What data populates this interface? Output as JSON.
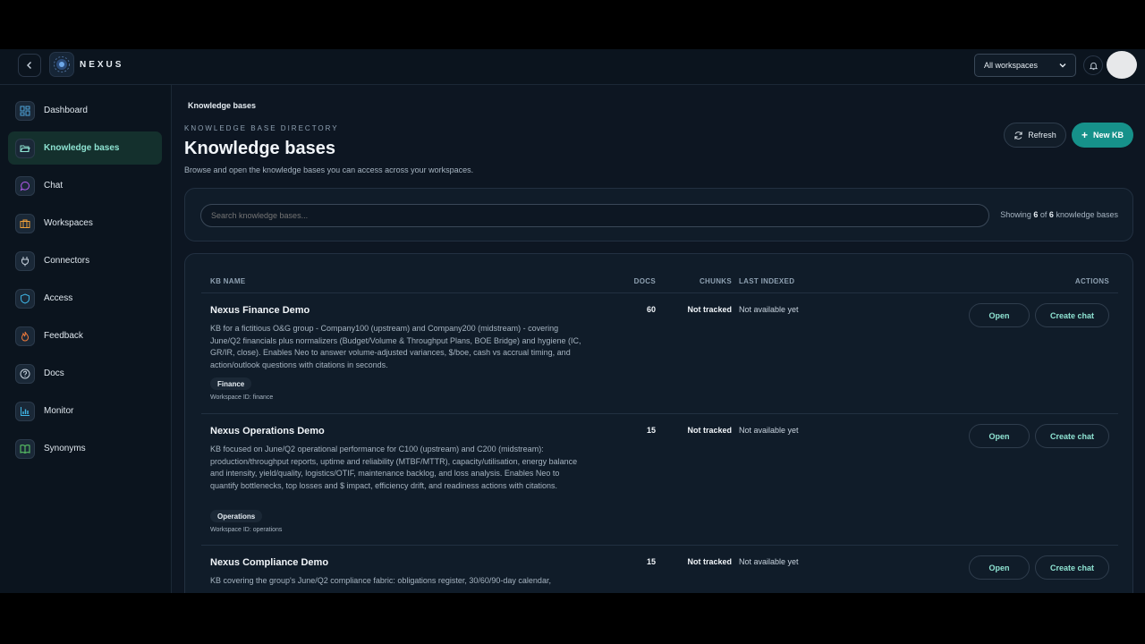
{
  "header": {
    "brand": "NEXUS",
    "workspace_select": "All workspaces",
    "icons": [
      "chevron-left-icon",
      "nexus-logo-icon",
      "bell-icon"
    ]
  },
  "sidebar": {
    "items": [
      {
        "label": "Dashboard",
        "icon": "dashboard-icon",
        "color": "#4fa3d9"
      },
      {
        "label": "Knowledge bases",
        "icon": "folder-open-icon",
        "color": "#8ee3d2",
        "active": true
      },
      {
        "label": "Chat",
        "icon": "chat-icon",
        "color": "#b45cf0"
      },
      {
        "label": "Workspaces",
        "icon": "briefcase-icon",
        "color": "#f0a13a"
      },
      {
        "label": "Connectors",
        "icon": "plug-icon",
        "color": "#c9d4df"
      },
      {
        "label": "Access",
        "icon": "shield-icon",
        "color": "#3fb7e8"
      },
      {
        "label": "Feedback",
        "icon": "flame-icon",
        "color": "#f07a3a"
      },
      {
        "label": "Docs",
        "icon": "help-circle-icon",
        "color": "#c9d4df"
      },
      {
        "label": "Monitor",
        "icon": "bar-chart-icon",
        "color": "#3fb7e8"
      },
      {
        "label": "Synonyms",
        "icon": "book-icon",
        "color": "#5fd36a"
      }
    ]
  },
  "main": {
    "breadcrumb": "Knowledge bases",
    "eyebrow": "KNOWLEDGE BASE DIRECTORY",
    "title": "Knowledge bases",
    "subtitle": "Browse and open the knowledge bases you can access across your workspaces.",
    "refresh_label": "Refresh",
    "new_label": "New KB",
    "search_placeholder": "Search knowledge bases...",
    "showing": {
      "prefix": "Showing",
      "count": "6",
      "of": "of",
      "total": "6",
      "suffix": "knowledge bases"
    }
  },
  "table": {
    "columns": {
      "name": "KB NAME",
      "docs": "DOCS",
      "chunks": "CHUNKS",
      "indexed": "LAST INDEXED",
      "actions": "ACTIONS"
    },
    "rows": [
      {
        "name": "Nexus Finance Demo",
        "description": "KB for a fictitious O&G group - Company100 (upstream) and Company200 (midstream) - covering June/Q2 financials plus normalizers (Budget/Volume & Throughput Plans, BOE Bridge) and hygiene (IC, GR/IR, close). Enables Neo to answer volume-adjusted variances, $/boe, cash vs accrual timing, and action/outlook questions with citations in seconds.",
        "tag": "Finance",
        "workspace_id": "Workspace ID: finance",
        "docs": "60",
        "chunks": "Not tracked",
        "indexed": "Not available yet",
        "open": "Open",
        "create_chat": "Create chat"
      },
      {
        "name": "Nexus Operations Demo",
        "description": "KB focused on June/Q2 operational performance for C100 (upstream) and C200 (midstream): production/throughput reports, uptime and reliability (MTBF/MTTR), capacity/utilisation, energy balance and intensity, yield/quality, logistics/OTIF, maintenance backlog, and loss analysis. Enables Neo to quantify bottlenecks, top losses and $ impact, efficiency drift, and readiness actions with citations.",
        "tag": "Operations",
        "workspace_id": "Workspace ID: operations",
        "docs": "15",
        "chunks": "Not tracked",
        "indexed": "Not available yet",
        "open": "Open",
        "create_chat": "Create chat"
      },
      {
        "name": "Nexus Compliance Demo",
        "description": "KB covering the group's June/Q2 compliance fabric: obligations register, 30/60/90-day calendar,",
        "tag": "",
        "workspace_id": "",
        "docs": "15",
        "chunks": "Not tracked",
        "indexed": "Not available yet",
        "open": "Open",
        "create_chat": "Create chat"
      }
    ]
  }
}
